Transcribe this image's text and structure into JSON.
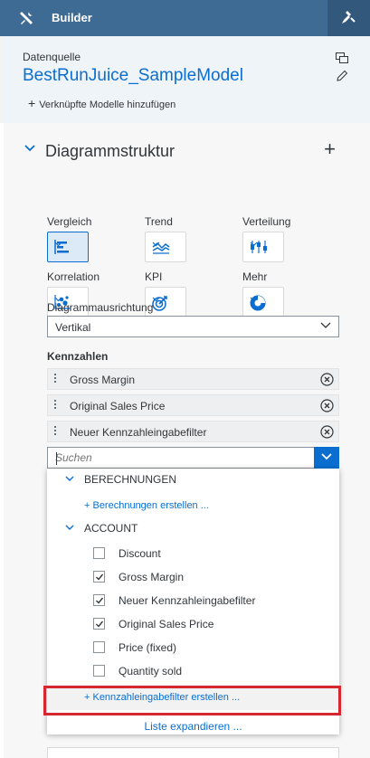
{
  "topbar": {
    "title": "Builder",
    "tools_icon": "tools-icon",
    "right_icon": "gavel-icon"
  },
  "datasource": {
    "label": "Datenquelle",
    "model_name": "BestRunJuice_SampleModel",
    "link_label": "Verknüpfte Modelle hinzufügen",
    "icons": [
      "copy-icon",
      "edit-pencil-icon"
    ]
  },
  "structure": {
    "title": "Diagrammstruktur",
    "chart_types": [
      {
        "label": "Vergleich",
        "icon": "bar-chart-icon",
        "active": true
      },
      {
        "label": "Trend",
        "icon": "area-chart-icon",
        "active": false
      },
      {
        "label": "Verteilung",
        "icon": "boxplot-icon",
        "active": false
      },
      {
        "label": "Korrelation",
        "icon": "scatter-icon",
        "active": false
      },
      {
        "label": "KPI",
        "icon": "target-icon",
        "active": false
      },
      {
        "label": "Mehr",
        "icon": "donut-icon",
        "active": false
      }
    ],
    "orientation": {
      "label": "Diagrammausrichtung",
      "value": "Vertikal"
    }
  },
  "measures": {
    "label": "Kennzahlen",
    "items": [
      "Gross Margin",
      "Original Sales Price",
      "Neuer Kennzahleingabefilter"
    ],
    "search_placeholder": "Suchen"
  },
  "dropdown": {
    "groups": [
      {
        "label": "BERECHNUNGEN",
        "link": "+ Berechnungen erstellen ..."
      },
      {
        "label": "ACCOUNT"
      }
    ],
    "options": [
      {
        "label": "Discount",
        "checked": false
      },
      {
        "label": "Gross Margin",
        "checked": true
      },
      {
        "label": "Neuer Kennzahleingabefilter",
        "checked": true
      },
      {
        "label": "Original Sales Price",
        "checked": true
      },
      {
        "label": "Price (fixed)",
        "checked": false
      },
      {
        "label": "Quantity sold",
        "checked": false
      }
    ],
    "create_filter": "+ Kennzahleingabefilter erstellen ...",
    "expand_list": "Liste expandieren ...",
    "highlight_color": "#d6262f"
  },
  "colors": {
    "header": "#3e6b93",
    "accent": "#0a6ed1"
  }
}
